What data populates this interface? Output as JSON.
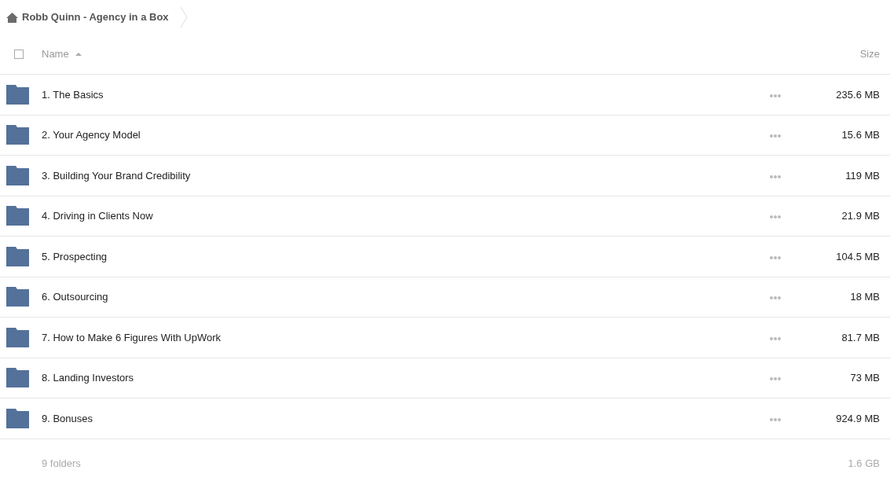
{
  "breadcrumb": {
    "title": "Robb Quinn - Agency in a Box"
  },
  "header": {
    "select_all": {
      "checked": false
    },
    "name_column": {
      "label": "Name",
      "sorted_ascending": true
    },
    "size_column": {
      "label": "Size"
    }
  },
  "rows": [
    {
      "name": "1. The Basics",
      "size": "235.6 MB"
    },
    {
      "name": "2. Your Agency Model",
      "size": "15.6 MB"
    },
    {
      "name": "3. Building Your Brand Credibility",
      "size": "119 MB"
    },
    {
      "name": "4. Driving in Clients Now",
      "size": "21.9 MB"
    },
    {
      "name": "5. Prospecting",
      "size": "104.5 MB"
    },
    {
      "name": "6. Outsourcing",
      "size": "18 MB"
    },
    {
      "name": "7. How to Make 6 Figures With UpWork",
      "size": "81.7 MB"
    },
    {
      "name": "8. Landing Investors",
      "size": "73 MB"
    },
    {
      "name": "9. Bonuses",
      "size": "924.9 MB"
    }
  ],
  "summary": {
    "count": "9 folders",
    "total": "1.6 GB"
  }
}
